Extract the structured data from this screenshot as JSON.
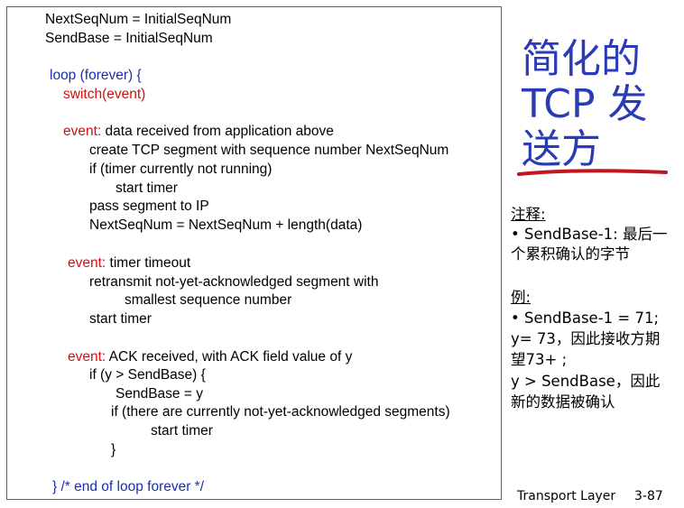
{
  "code": {
    "init": [
      "NextSeqNum = InitialSeqNum",
      "SendBase = InitialSeqNum"
    ],
    "loop_open": "loop (forever) {",
    "switch": "switch(event)",
    "ev1": {
      "keyword": "event:",
      "text": " data received from application above",
      "lines": [
        "create TCP segment with sequence number NextSeqNum",
        "if (timer currently not running)",
        "start timer",
        "pass segment to IP",
        "NextSeqNum = NextSeqNum + length(data)"
      ]
    },
    "ev2": {
      "keyword": "event:",
      "text": " timer timeout",
      "lines": [
        "retransmit not-yet-acknowledged segment with",
        "smallest sequence number",
        "start timer"
      ]
    },
    "ev3": {
      "keyword": "event:",
      "text": " ACK received, with ACK field value of y",
      "lines": [
        "if (y > SendBase) {",
        "SendBase = y",
        "if (there are currently not-yet-acknowledged segments)",
        "start timer",
        "}"
      ]
    },
    "loop_close": "}  /* end of loop forever */"
  },
  "title": [
    "简化的",
    "TCP 发",
    "送方"
  ],
  "notes": {
    "note_label": "注释:",
    "note_lines": [
      "• SendBase-1: 最后一",
      "个累积确认的字节"
    ],
    "example_label": "例:",
    "example_lines": [
      "• SendBase-1 = 71;",
      "y= 73，因此接收方期",
      "望73+ ;",
      "y > SendBase，因此",
      "新的数据被确认"
    ]
  },
  "footer": {
    "label": "Transport Layer",
    "page": "3-87"
  }
}
